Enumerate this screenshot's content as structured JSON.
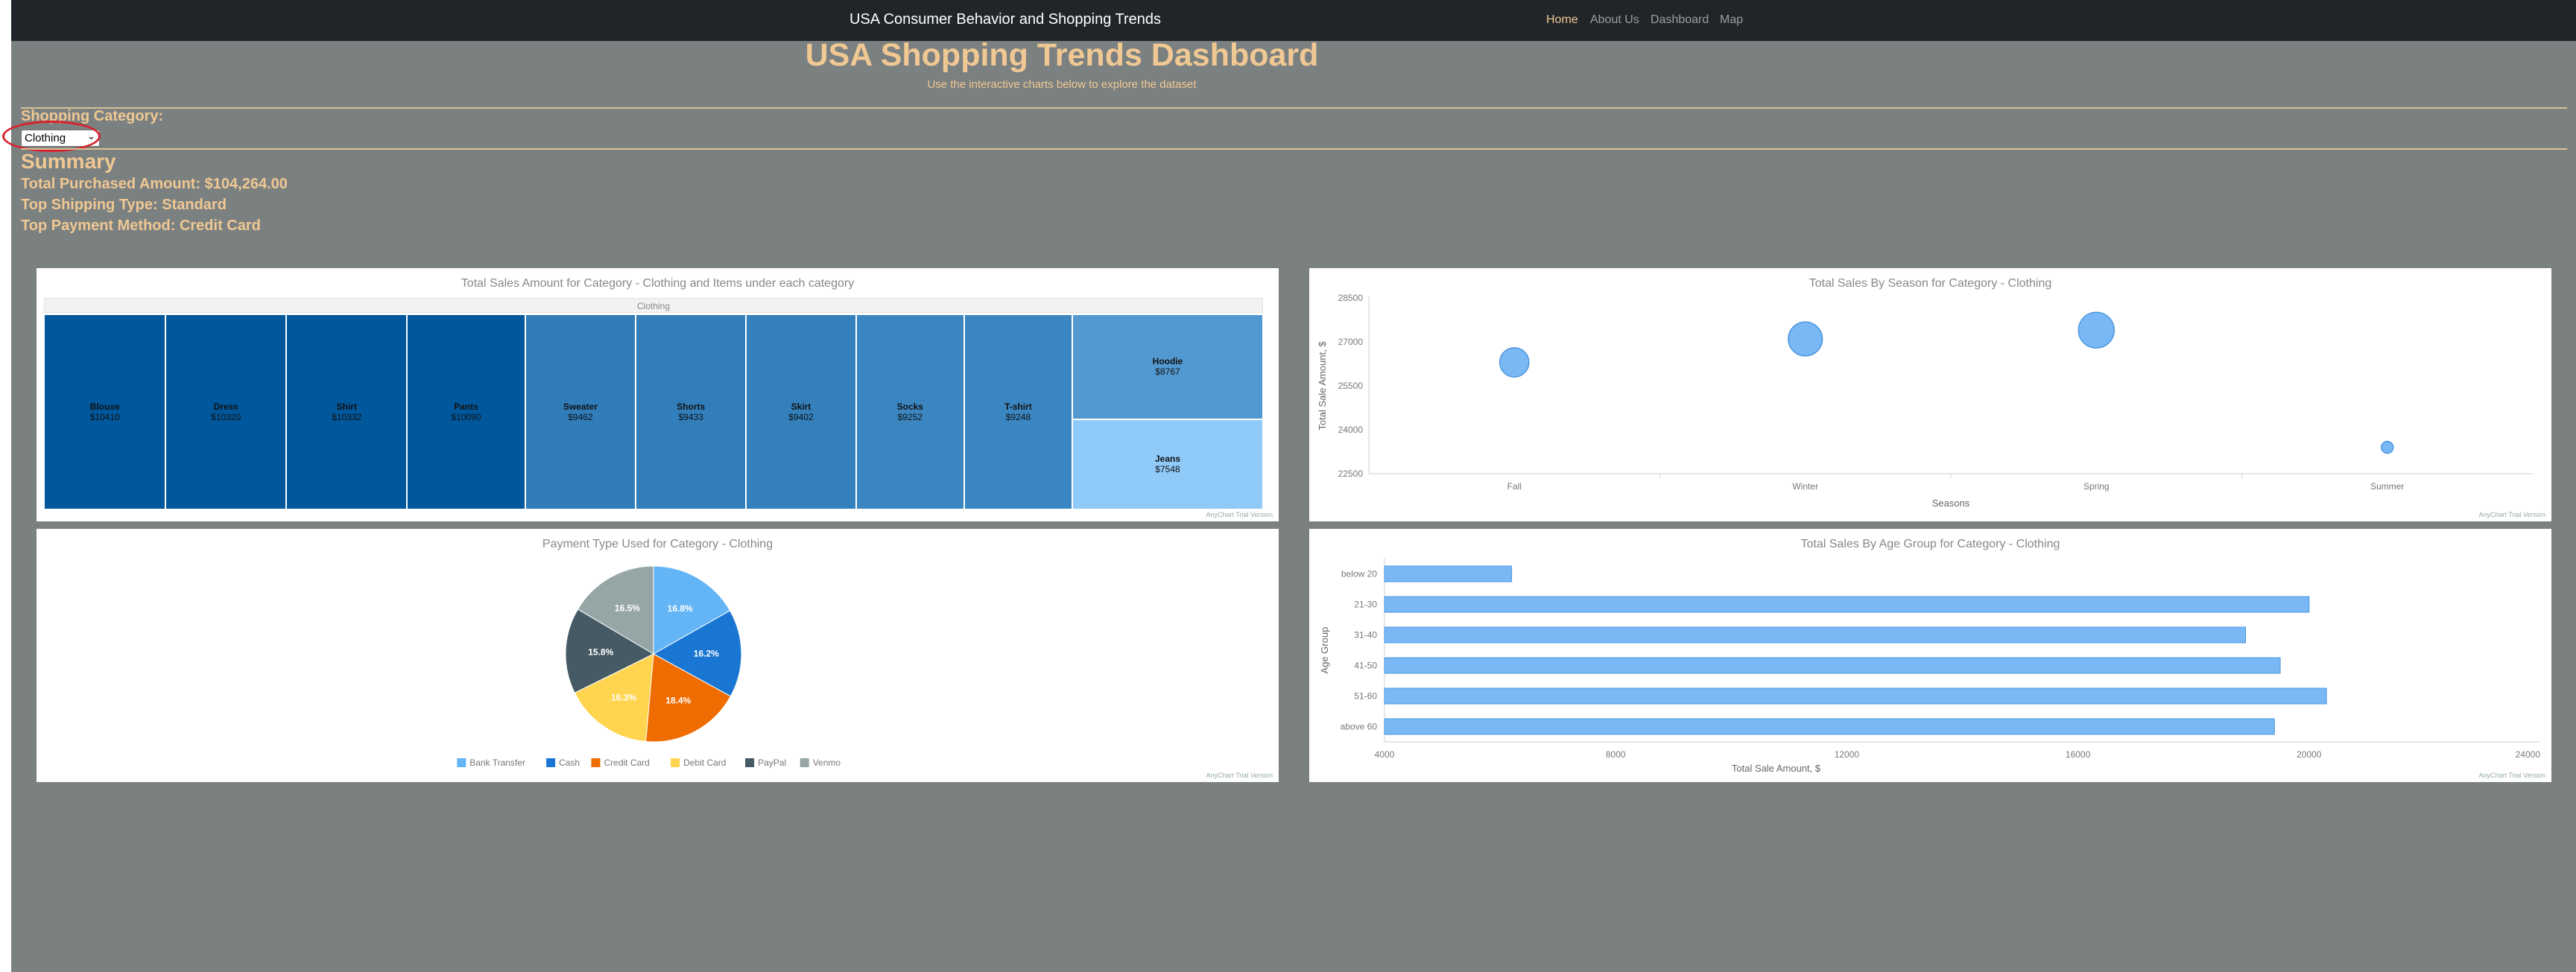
{
  "navbar": {
    "brand": "USA Consumer Behavior and Shopping Trends",
    "links": [
      {
        "label": "Home",
        "active": true
      },
      {
        "label": "About Us",
        "active": false
      },
      {
        "label": "Dashboard",
        "active": false
      },
      {
        "label": "Map",
        "active": false
      }
    ]
  },
  "header": {
    "title": "USA Shopping Trends Dashboard",
    "subtitle": "Use the interactive charts below to explore the dataset"
  },
  "filter": {
    "label": "Shopping Category:",
    "selected": "Clothing"
  },
  "summary": {
    "heading": "Summary",
    "total": "Total Purchased Amount: $104,264.00",
    "shipping": "Top Shipping Type: Standard",
    "payment": "Top Payment Method: Credit Card"
  },
  "trial_label": "AnyChart Trial Version",
  "colors": {
    "navbar": "#212529",
    "background": "#7b8080",
    "accent": "#f0c893",
    "highlight": "#d8222d"
  },
  "chart_data": [
    {
      "type": "treemap",
      "title": "Total Sales Amount for Category - Clothing and Items under each category",
      "root": "Clothing",
      "items": [
        {
          "name": "Blouse",
          "label": "$10410",
          "value": 10410
        },
        {
          "name": "Dress",
          "label": "$10320",
          "value": 10320
        },
        {
          "name": "Shirt",
          "label": "$10332",
          "value": 10332
        },
        {
          "name": "Pants",
          "label": "$10090",
          "value": 10090
        },
        {
          "name": "Sweater",
          "label": "$9462",
          "value": 9462
        },
        {
          "name": "Shorts",
          "label": "$9433",
          "value": 9433
        },
        {
          "name": "Skirt",
          "label": "$9402",
          "value": 9402
        },
        {
          "name": "Socks",
          "label": "$9252",
          "value": 9252
        },
        {
          "name": "T-shirt",
          "label": "$9248",
          "value": 9248
        },
        {
          "name": "Hoodie",
          "label": "$8767",
          "value": 8767
        },
        {
          "name": "Jeans",
          "label": "$7548",
          "value": 7548
        }
      ]
    },
    {
      "type": "scatter",
      "title": "Total Sales By Season for Category - Clothing",
      "xlabel": "Seasons",
      "ylabel": "Total Sale Amount, $",
      "categories": [
        "Fall",
        "Winter",
        "Spring",
        "Summer"
      ],
      "values": [
        26300,
        27100,
        27400,
        23400
      ],
      "yticks": [
        "22500",
        "24000",
        "25500",
        "27000",
        "28500"
      ],
      "ylim": [
        22500,
        28500
      ],
      "color": "#7ab8f5"
    },
    {
      "type": "pie",
      "title": "Payment Type Used for Category - Clothing",
      "slices": [
        {
          "name": "Bank Transfer",
          "value": 16.8,
          "label": "16.8%",
          "color": "#64b5f6"
        },
        {
          "name": "Cash",
          "value": 16.2,
          "label": "16.2%",
          "color": "#1976d2"
        },
        {
          "name": "Credit Card",
          "value": 18.4,
          "label": "18.4%",
          "color": "#ef6c00"
        },
        {
          "name": "Debit Card",
          "value": 16.3,
          "label": "16.3%",
          "color": "#ffd54f"
        },
        {
          "name": "PayPal",
          "value": 15.8,
          "label": "15.8%",
          "color": "#455a64"
        },
        {
          "name": "Venmo",
          "value": 16.5,
          "label": "16.5%",
          "color": "#96a6a6"
        }
      ]
    },
    {
      "type": "bar",
      "orientation": "horizontal",
      "title": "Total Sales By Age Group for Category - Clothing",
      "xlabel": "Total Sale Amount, $",
      "ylabel": "Age Group",
      "categories": [
        "below 20",
        "21-30",
        "31-40",
        "41-50",
        "51-60",
        "above 60"
      ],
      "values": [
        6200,
        20000,
        18900,
        19500,
        20300,
        19400
      ],
      "xticks": [
        "4000",
        "8000",
        "12000",
        "16000",
        "20000",
        "24000"
      ],
      "xlim": [
        4000,
        24000
      ],
      "color": "#7ab8f5"
    }
  ]
}
